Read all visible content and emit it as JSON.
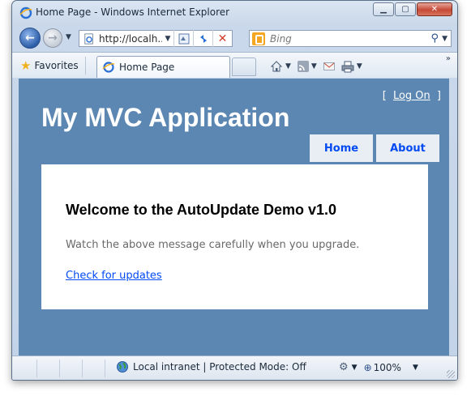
{
  "window": {
    "title": "Home Page - Windows Internet Explorer"
  },
  "address": {
    "url": "http://localh..."
  },
  "search": {
    "placeholder": "Bing"
  },
  "favorites": {
    "label": "Favorites"
  },
  "tabs": [
    {
      "label": "Home Page"
    }
  ],
  "page": {
    "login": {
      "open_bracket": "[",
      "link": "Log On",
      "close_bracket": "]"
    },
    "title": "My MVC Application",
    "menu": [
      {
        "label": "Home"
      },
      {
        "label": "About"
      }
    ],
    "heading": "Welcome to the AutoUpdate Demo v1.0",
    "message": "Watch the above message carefully when you upgrade.",
    "update_link": "Check for updates"
  },
  "statusbar": {
    "zone": "Local intranet | Protected Mode: Off",
    "zoom": "100%"
  },
  "colors": {
    "page_bg": "#5c87b2",
    "link": "#034af3",
    "menu_bg": "#e8eef4"
  },
  "icons": [
    "ie-page-icon",
    "back-arrow-icon",
    "forward-arrow-icon",
    "compat-view-icon",
    "refresh-icon",
    "stop-icon",
    "bing-icon",
    "search-icon",
    "star-icon",
    "home-icon",
    "rss-icon",
    "mail-icon",
    "print-icon",
    "globe-icon",
    "security-icon",
    "zoom-icon"
  ]
}
